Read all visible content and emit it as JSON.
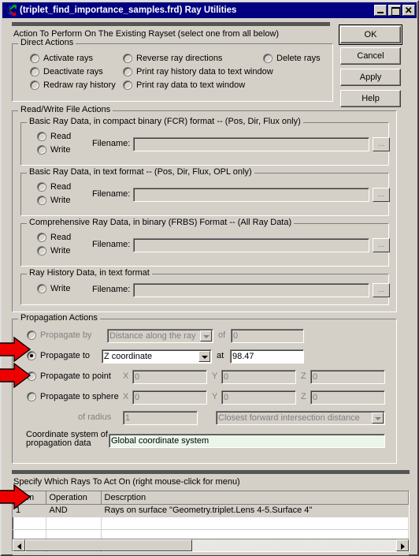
{
  "window": {
    "title": "(triplet_find_importance_samples.frd) Ray Utilities",
    "icon": "fred-ray-icon",
    "controls": [
      {
        "name": "minimize-button",
        "label": "_"
      },
      {
        "name": "maximize-button",
        "label": "□"
      },
      {
        "name": "close-button",
        "label": "✕"
      }
    ]
  },
  "buttons": {
    "ok": "OK",
    "cancel": "Cancel",
    "apply": "Apply",
    "help": "Help"
  },
  "action_header": "Action To Perform On The Existing Rayset (select one from all below)",
  "direct_actions": {
    "title": "Direct Actions",
    "options": [
      {
        "label": "Activate rays",
        "checked": false
      },
      {
        "label": "Deactivate rays",
        "checked": false
      },
      {
        "label": "Redraw ray history",
        "checked": false
      },
      {
        "label": "Reverse ray directions",
        "checked": false
      },
      {
        "label": "Print ray history data to text window",
        "checked": false
      },
      {
        "label": "Print ray data to text window",
        "checked": false
      },
      {
        "label": "Delete rays",
        "checked": false
      }
    ]
  },
  "file_actions": {
    "title": "Read/Write File Actions",
    "filename_label": "Filename:",
    "browse_label": "...",
    "groups": [
      {
        "title": "Basic Ray Data, in compact binary (FCR) format -- (Pos, Dir, Flux only)",
        "modes": [
          {
            "label": "Read",
            "checked": false
          },
          {
            "label": "Write",
            "checked": false
          }
        ],
        "filename": ""
      },
      {
        "title": "Basic Ray Data, in text format  -- (Pos, Dir, Flux, OPL only)",
        "modes": [
          {
            "label": "Read",
            "checked": false
          },
          {
            "label": "Write",
            "checked": false
          }
        ],
        "filename": ""
      },
      {
        "title": "Comprehensive Ray Data, in binary (FRBS) Format -- (All Ray Data)",
        "modes": [
          {
            "label": "Read",
            "checked": false
          },
          {
            "label": "Write",
            "checked": false
          }
        ],
        "filename": ""
      },
      {
        "title": "Ray History Data, in text format",
        "modes": [
          {
            "label": "Write",
            "checked": false
          }
        ],
        "filename": ""
      }
    ]
  },
  "propagation": {
    "title": "Propagation Actions",
    "propagate_by": {
      "label": "Propagate by",
      "checked": false,
      "mode_value": "Distance along the ray",
      "of_label": "of",
      "of_value": "0",
      "disabled": true
    },
    "propagate_to": {
      "label": "Propagate to",
      "checked": true,
      "mode_value": "Z coordinate",
      "at_label": "at",
      "at_value": "98.47",
      "disabled": false
    },
    "propagate_to_point": {
      "label": "Propagate to point",
      "checked": false,
      "x_label": "X",
      "x_value": "0",
      "y_label": "Y",
      "y_value": "0",
      "z_label": "Z",
      "z_value": "0"
    },
    "propagate_to_sphere": {
      "label": "Propagate to sphere",
      "checked": false,
      "x_label": "X",
      "x_value": "0",
      "y_label": "Y",
      "y_value": "0",
      "z_label": "Z",
      "z_value": "0",
      "radius_label": "of radius",
      "radius_value": "1",
      "intersection_value": "Closest forward intersection distance"
    },
    "coord_system": {
      "label_line1": "Coordinate system of",
      "label_line2": "propagation data",
      "value": "Global coordinate system"
    }
  },
  "rays_section": {
    "header": "Specify Which Rays To Act On   (right mouse-click for menu)",
    "columns": [
      "Num",
      "Operation",
      "Descrption"
    ],
    "rows": [
      {
        "num": "1",
        "operation": "AND",
        "description": "Rays on surface \"Geometry.triplet.Lens 4-5.Surface 4\"",
        "selected": true
      },
      {
        "num": "",
        "operation": "",
        "description": "",
        "selected": false
      },
      {
        "num": "",
        "operation": "",
        "description": "",
        "selected": false
      },
      {
        "num": "",
        "operation": "",
        "description": "",
        "selected": false
      }
    ]
  },
  "annotations": {
    "arrow_color": "#ee0000",
    "arrows": [
      {
        "name": "arrow-propagate-to",
        "target": "propagate-to-radio"
      },
      {
        "name": "arrow-propagate-to-point",
        "target": "propagate-to-point-radio"
      },
      {
        "name": "arrow-rays-table-row",
        "target": "rays-table-first-row"
      }
    ]
  }
}
